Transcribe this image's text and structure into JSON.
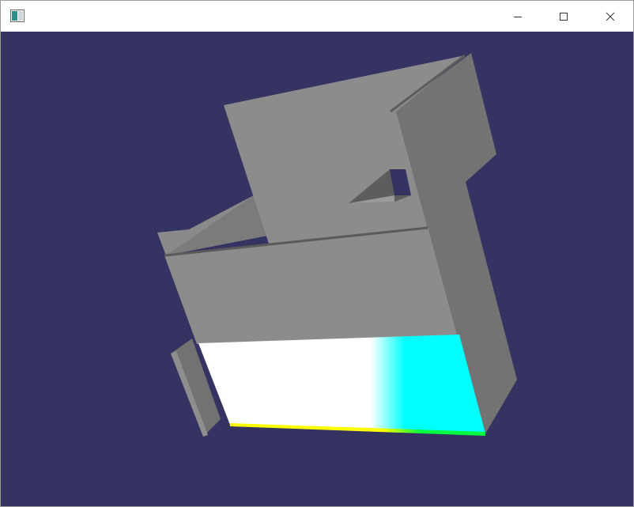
{
  "window": {
    "title": "",
    "controls": {
      "minimize": "minimize-icon",
      "maximize": "maximize-icon",
      "close": "close-icon"
    }
  },
  "scene": {
    "background_color": "#343362",
    "model_color": "#8c8c8c",
    "highlight_colors": [
      "#ffffff",
      "#00ffff",
      "#ffff00",
      "#00ff40"
    ]
  }
}
